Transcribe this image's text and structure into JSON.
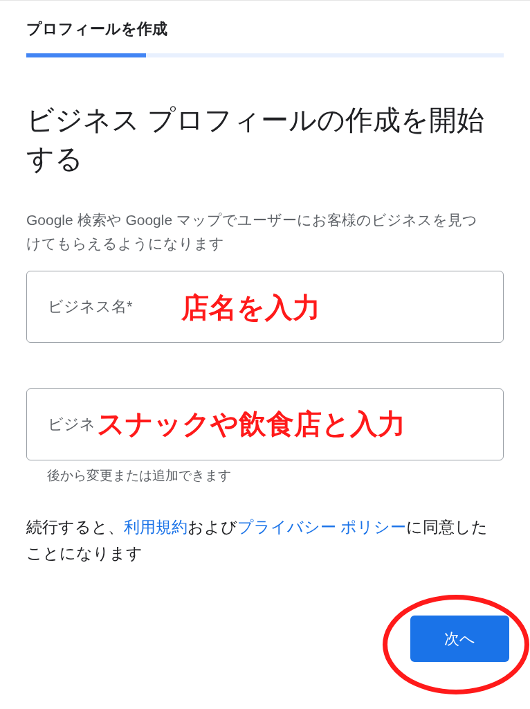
{
  "header": {
    "title": "プロフィールを作成",
    "progress": {
      "level": 0.25
    }
  },
  "heading": "ビジネス プロフィールの作成を開始する",
  "description": "Google 検索や Google マップでユーザーにお客様のビジネスを見つけてもらえるようになります",
  "fields": [
    {
      "placeholder": "ビジネス名*",
      "annotation": "店名を入力"
    },
    {
      "placeholder": "ビジネ",
      "annotation": "スナックや飲食店と入力",
      "helper": "後から変更または追加できます"
    }
  ],
  "terms": [
    {
      "kind": "text",
      "text": "続行すると、"
    },
    {
      "kind": "link",
      "text": "利用規約"
    },
    {
      "kind": "text",
      "text": "および"
    },
    {
      "kind": "link",
      "text": "プライバシー ポリシー"
    },
    {
      "kind": "text",
      "text": "に同意したことになります"
    }
  ],
  "next_button": {
    "label": "次へ",
    "circled": true
  }
}
